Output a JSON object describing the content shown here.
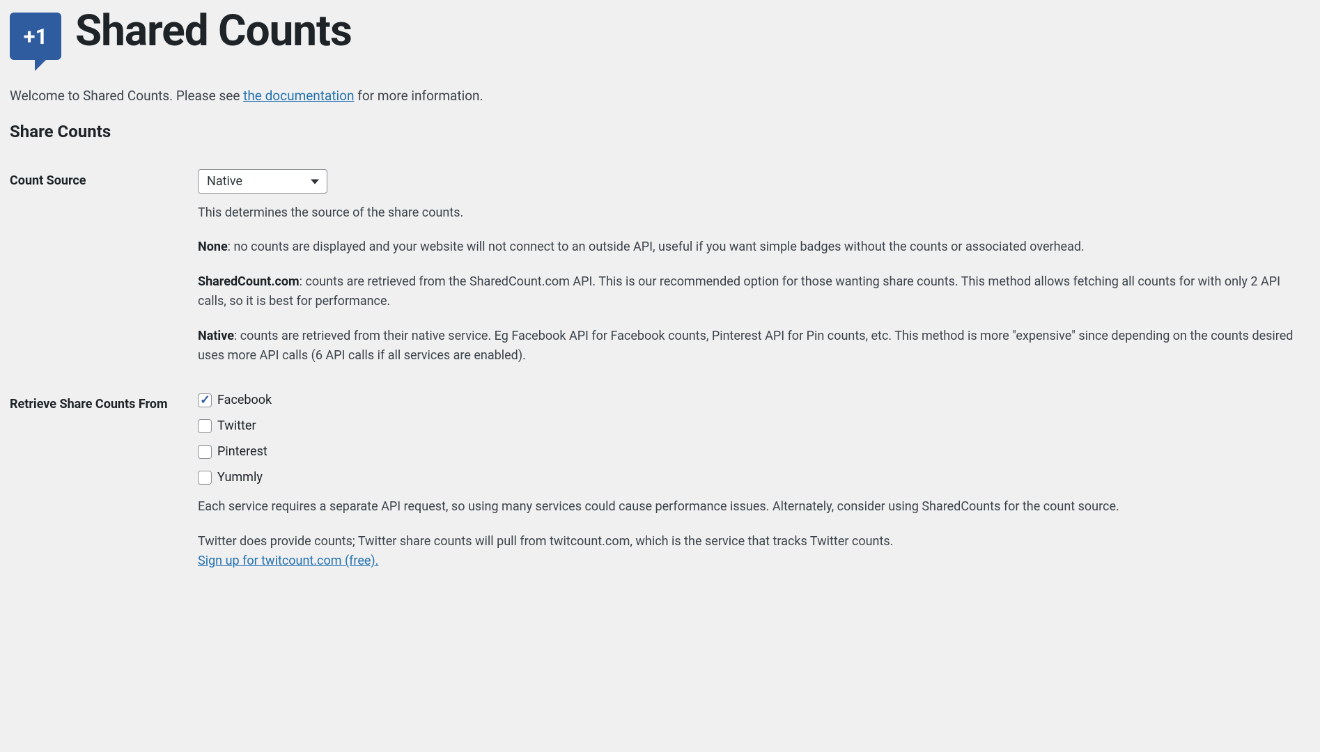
{
  "header": {
    "logo_text": "+1",
    "title": "Shared Counts"
  },
  "welcome": {
    "prefix": "Welcome to Shared Counts. Please see ",
    "link_text": "the documentation",
    "suffix": " for more information."
  },
  "section_heading": "Share Counts",
  "count_source": {
    "label": "Count Source",
    "selected": "Native",
    "help": "This determines the source of the share counts.",
    "options": {
      "none": {
        "name": "None",
        "desc": ": no counts are displayed and your website will not connect to an outside API, useful if you want simple badges without the counts or associated overhead."
      },
      "sharedcount": {
        "name": "SharedCount.com",
        "desc": ": counts are retrieved from the SharedCount.com API. This is our recommended option for those wanting share counts. This method allows fetching all counts for with only 2 API calls, so it is best for performance."
      },
      "native": {
        "name": "Native",
        "desc": ": counts are retrieved from their native service. Eg Facebook API for Facebook counts, Pinterest API for Pin counts, etc. This method is more \"expensive\" since depending on the counts desired uses more API calls (6 API calls if all services are enabled)."
      }
    }
  },
  "retrieve_from": {
    "label": "Retrieve Share Counts From",
    "services": [
      {
        "label": "Facebook",
        "checked": true
      },
      {
        "label": "Twitter",
        "checked": false
      },
      {
        "label": "Pinterest",
        "checked": false
      },
      {
        "label": "Yummly",
        "checked": false
      }
    ],
    "note1": "Each service requires a separate API request, so using many services could cause performance issues. Alternately, consider using SharedCounts for the count source.",
    "note2_prefix": "Twitter does provide counts; Twitter share counts will pull from twitcount.com, which is the service that tracks Twitter counts.",
    "note2_link": "Sign up for twitcount.com (free)."
  }
}
